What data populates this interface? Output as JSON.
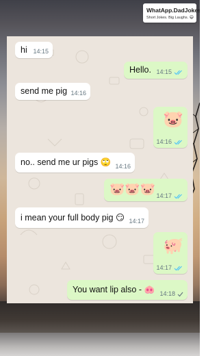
{
  "watermark": {
    "title": "WhatApp.DadJokes",
    "subtitle": "Short Jokes. Big Laughs.",
    "subtitle_emoji": "😄"
  },
  "colors": {
    "incoming_bubble": "#ffffff",
    "outgoing_bubble": "#dcf8c6",
    "read_ticks": "#4fc3f7",
    "sent_tick": "#8696a0",
    "timestamp": "#667781"
  },
  "messages": [
    {
      "direction": "incoming",
      "text": "hi",
      "time": "14:15"
    },
    {
      "direction": "outgoing",
      "text": "Hello.",
      "time": "14:15",
      "status": "read-double-tick"
    },
    {
      "direction": "incoming",
      "text": "send me pig",
      "time": "14:16"
    },
    {
      "direction": "outgoing",
      "text": "🐷",
      "time": "14:16",
      "status": "read-double-tick"
    },
    {
      "direction": "incoming",
      "text": "no.. send me ur pigs 🙄",
      "time": "14:16"
    },
    {
      "direction": "outgoing",
      "text": "🐷🐷🐷",
      "time": "14:17",
      "status": "read-double-tick"
    },
    {
      "direction": "incoming",
      "text": "i mean your full body pig 😏",
      "time": "14:17"
    },
    {
      "direction": "outgoing",
      "text": "🐖",
      "time": "14:17",
      "status": "read-double-tick"
    },
    {
      "direction": "outgoing",
      "text": "You want lip also - 🐽",
      "time": "14:18",
      "status": "sent-single-tick"
    }
  ]
}
